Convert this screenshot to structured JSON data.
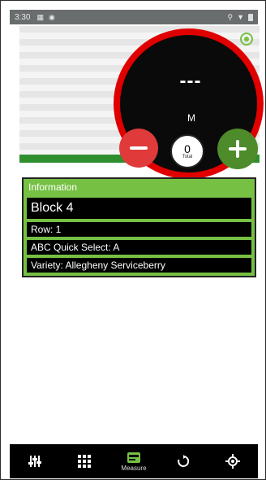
{
  "status_bar": {
    "time": "3:30",
    "left_icons": [
      "notification-icon",
      "sync-icon"
    ],
    "right_icons": [
      "location-icon",
      "wifi-icon",
      "battery-icon"
    ]
  },
  "measure": {
    "value": "---",
    "unit": "M",
    "total_count": "0",
    "total_label": "Total",
    "ring_color": "#e00000",
    "plus_color": "#4d8b2b",
    "minus_color": "#e03a3a"
  },
  "info": {
    "header": "Information",
    "block": "Block 4",
    "row": "Row: 1",
    "abc": "ABC Quick Select: A",
    "variety": "Variety: Allegheny Serviceberry",
    "accent": "#76c043"
  },
  "nav": {
    "items": [
      {
        "icon": "sliders-icon",
        "label": ""
      },
      {
        "icon": "grid-icon",
        "label": ""
      },
      {
        "icon": "measure-icon",
        "label": "Measure",
        "active": true
      },
      {
        "icon": "refresh-icon",
        "label": ""
      },
      {
        "icon": "settings-icon",
        "label": ""
      }
    ]
  }
}
